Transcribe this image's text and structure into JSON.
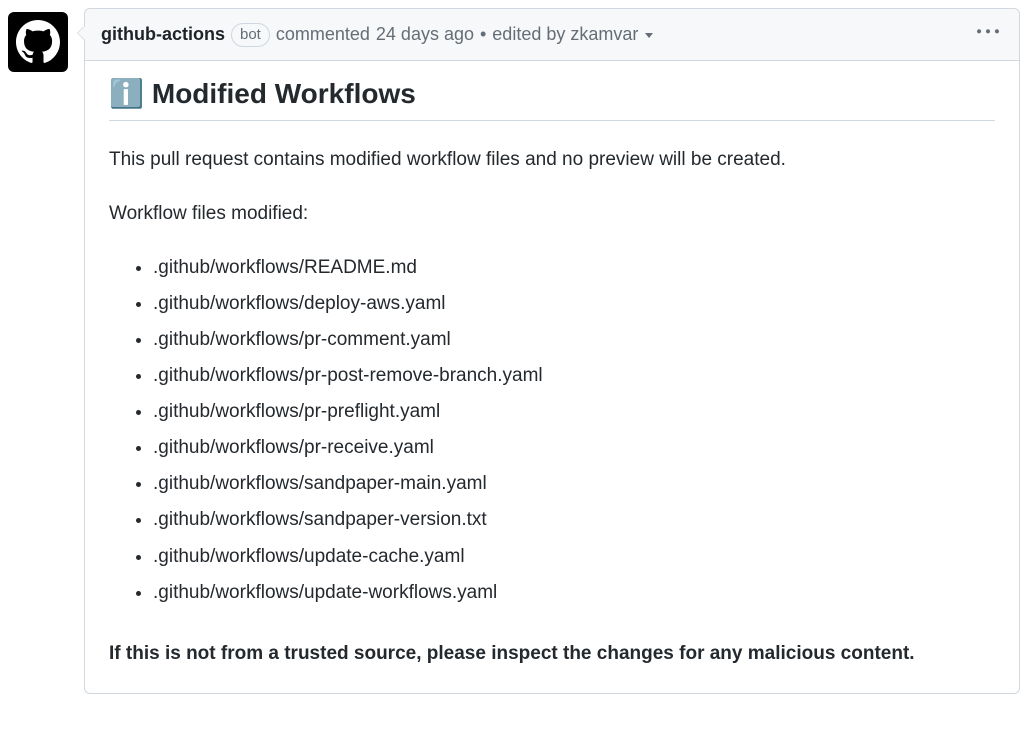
{
  "comment": {
    "author": "github-actions",
    "bot_badge": "bot",
    "action_text": "commented",
    "timestamp": "24 days ago",
    "separator": "•",
    "edited_prefix": "edited by",
    "edited_by": "zkamvar",
    "heading_icon": "ℹ️",
    "heading_text": "Modified Workflows",
    "intro_text": "This pull request contains modified workflow files and no preview will be created.",
    "files_label": "Workflow files modified:",
    "files": [
      ".github/workflows/README.md",
      ".github/workflows/deploy-aws.yaml",
      ".github/workflows/pr-comment.yaml",
      ".github/workflows/pr-post-remove-branch.yaml",
      ".github/workflows/pr-preflight.yaml",
      ".github/workflows/pr-receive.yaml",
      ".github/workflows/sandpaper-main.yaml",
      ".github/workflows/sandpaper-version.txt",
      ".github/workflows/update-cache.yaml",
      ".github/workflows/update-workflows.yaml"
    ],
    "warning_text": "If this is not from a trusted source, please inspect the changes for any malicious content."
  }
}
